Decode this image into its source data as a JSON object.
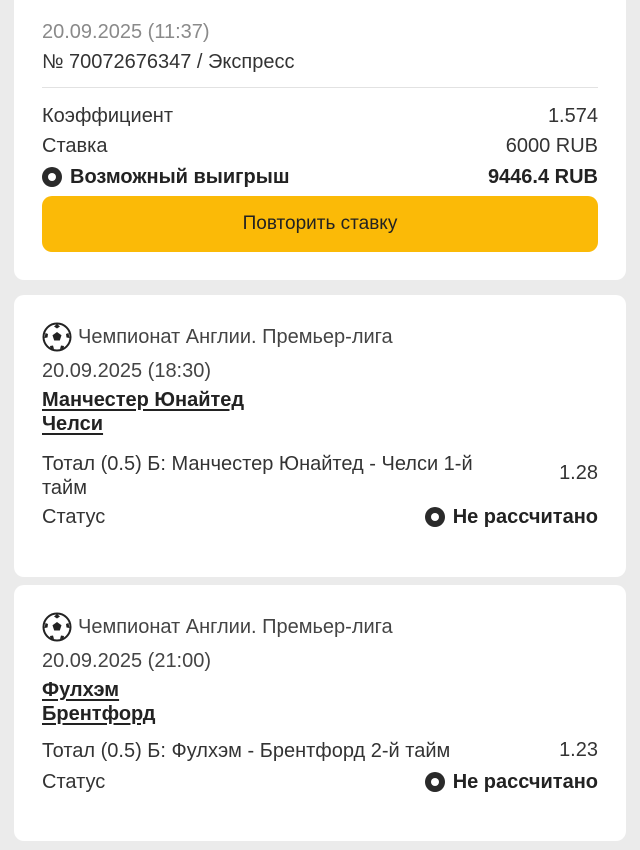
{
  "summary": {
    "datetime": "20.09.2025 (11:37)",
    "bet_number": "№ 70072676347 / Экспресс",
    "coef_label": "Коэффициент",
    "coef_value": "1.574",
    "stake_label": "Ставка",
    "stake_value": "6000 RUB",
    "win_label": "Возможный выигрыш",
    "win_value": "9446.4 RUB",
    "repeat_button": "Повторить ставку"
  },
  "events": [
    {
      "league": "Чемпионат Англии. Премьер-лига",
      "datetime": "20.09.2025 (18:30)",
      "team1": "Манчестер Юнайтед",
      "team2": "Челси",
      "market": "Тотал (0.5) Б: Манчестер Юнайтед - Челси 1-й тайм",
      "coef": "1.28",
      "status_label": "Статус",
      "status_value": "Не рассчитано"
    },
    {
      "league": "Чемпионат Англии. Премьер-лига",
      "datetime": "20.09.2025 (21:00)",
      "team1": "Фулхэм",
      "team2": "Брентфорд",
      "market": "Тотал (0.5) Б: Фулхэм - Брентфорд 2-й тайм",
      "coef": "1.23",
      "status_label": "Статус",
      "status_value": "Не рассчитано"
    }
  ],
  "colors": {
    "accent": "#fbba07",
    "background": "#ebebeb",
    "card": "#ffffff"
  },
  "icons": {
    "league": "soccer-ball-icon",
    "status": "radio-dot-icon"
  }
}
